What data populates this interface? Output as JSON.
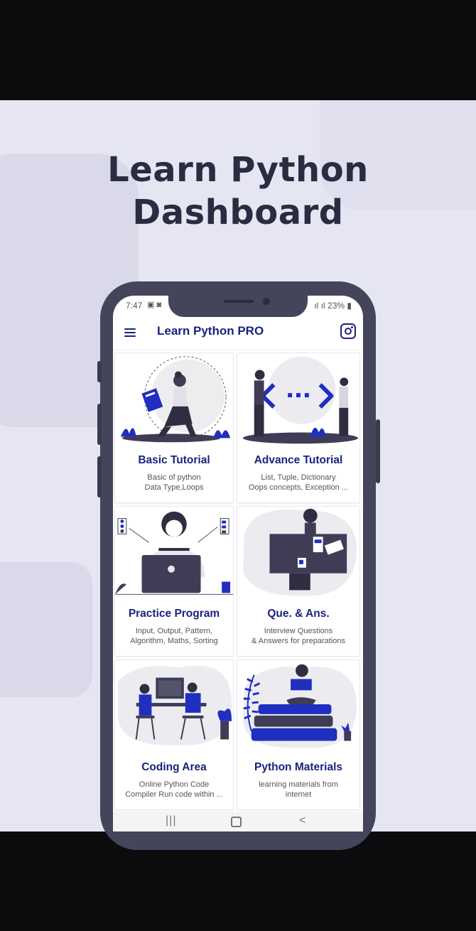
{
  "promo": {
    "headline_line1": "Learn Python",
    "headline_line2": "Dashboard"
  },
  "status_bar": {
    "time": "7:47",
    "battery": "23%"
  },
  "app_bar": {
    "title": "Learn Python PRO",
    "menu_icon": "hamburger-menu-icon",
    "action_icon": "instagram-icon"
  },
  "cards": [
    {
      "title": "Basic Tutorial",
      "description": "Basic of python\nData Type,Loops"
    },
    {
      "title": "Advance Tutorial",
      "description": "List, Tuple, Dictionary\nOops concepts, Exception ..."
    },
    {
      "title": "Practice Program",
      "description": "Input, Output, Pattern,\nAlgorithm, Maths, Sorting"
    },
    {
      "title": "Que. & Ans.",
      "description": "Interview Questions\n& Answers for preparations"
    },
    {
      "title": "Coding Area",
      "description": "Online Python Code\nCompiler Run code within ..."
    },
    {
      "title": "Python Materials",
      "description": "learning materials from\ninternet"
    }
  ],
  "nav_bar": {
    "recents": "|||",
    "back": "<"
  },
  "colors": {
    "accent": "#1a237e",
    "illustration_blue": "#1f2fbf",
    "dark": "#3f3d56",
    "promo_bg": "#e6e6f2"
  }
}
